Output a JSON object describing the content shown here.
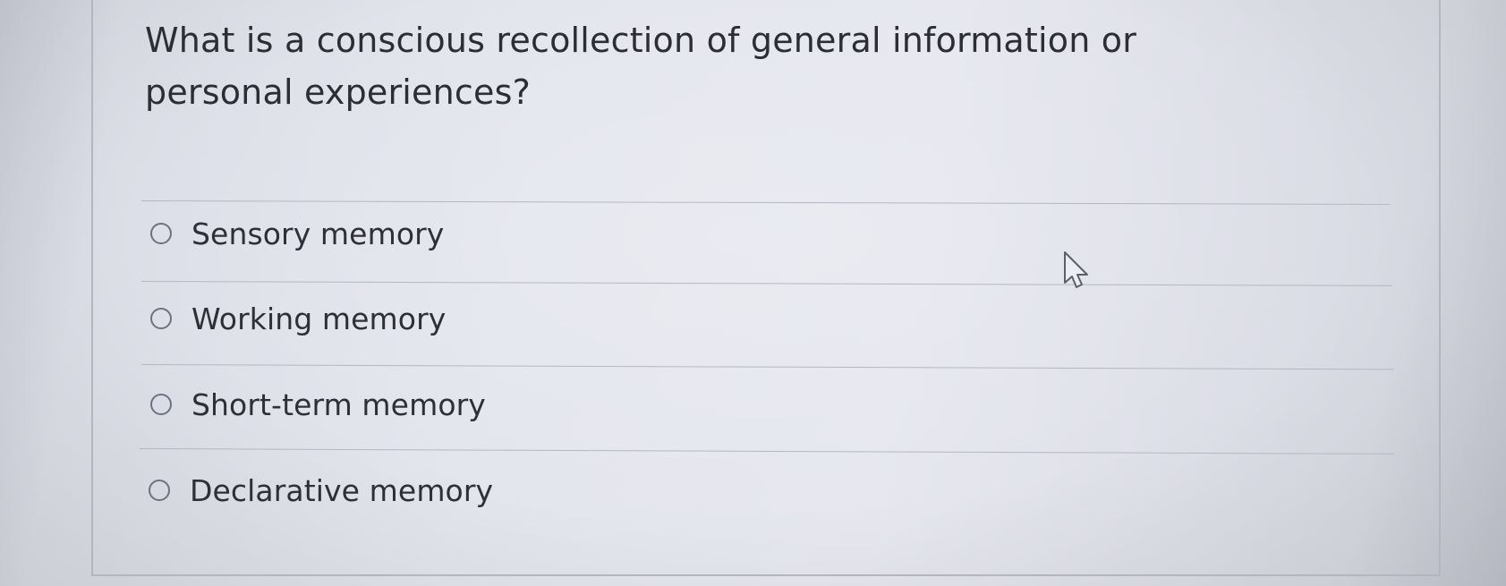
{
  "question": {
    "text": "What is a conscious recollection of general information or personal experiences?"
  },
  "options": [
    {
      "label": "Sensory memory",
      "selected": false
    },
    {
      "label": "Working memory",
      "selected": false
    },
    {
      "label": "Short-term memory",
      "selected": false
    },
    {
      "label": "Declarative memory",
      "selected": false
    }
  ],
  "cursor": {
    "icon": "arrow-pointer-icon"
  }
}
